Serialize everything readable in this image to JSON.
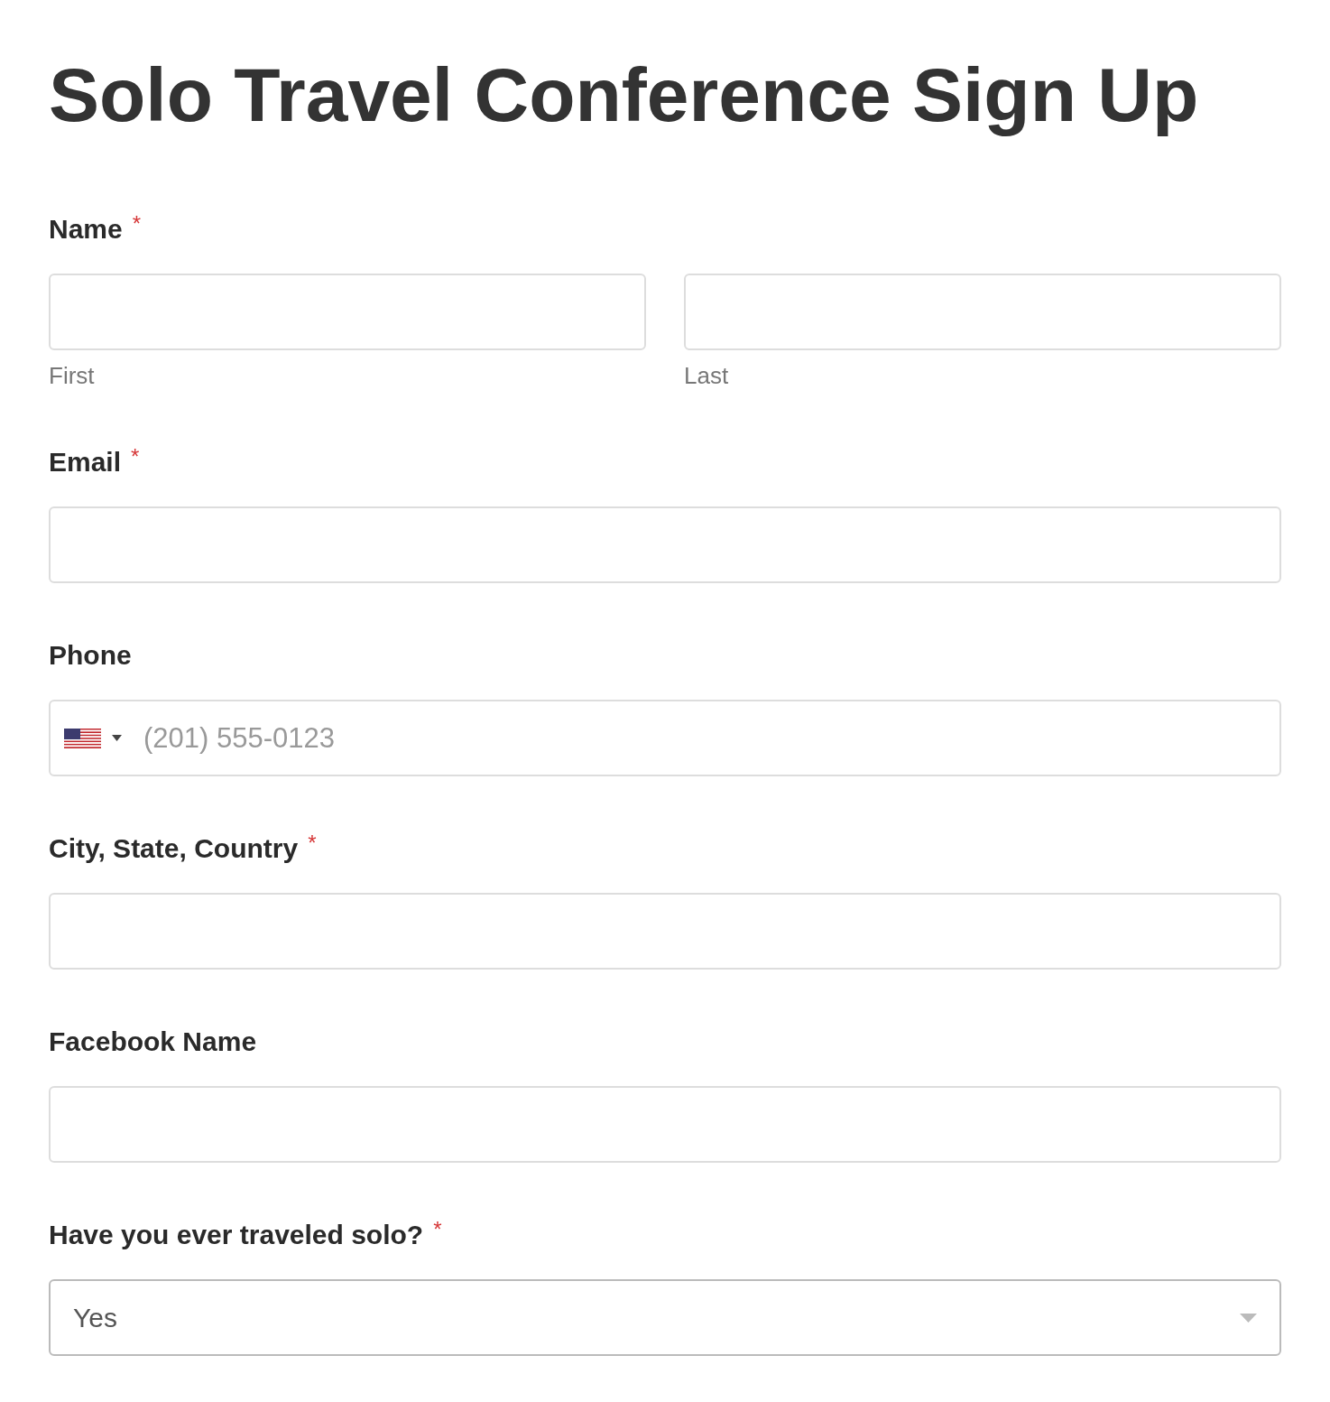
{
  "title": "Solo Travel Conference Sign Up",
  "fields": [
    {
      "kind": "name",
      "label": "Name",
      "required_mark": "*",
      "subfields": [
        {
          "sublabel": "First"
        },
        {
          "sublabel": "Last"
        }
      ]
    },
    {
      "kind": "text",
      "label": "Email",
      "required_mark": "*"
    },
    {
      "kind": "phone",
      "label": "Phone",
      "placeholder": "(201) 555-0123"
    },
    {
      "kind": "text",
      "label": "City, State, Country",
      "required_mark": "*"
    },
    {
      "kind": "text",
      "label": "Facebook Name"
    },
    {
      "kind": "select",
      "label": "Have you ever traveled solo?",
      "required_mark": "*",
      "value": "Yes"
    }
  ]
}
